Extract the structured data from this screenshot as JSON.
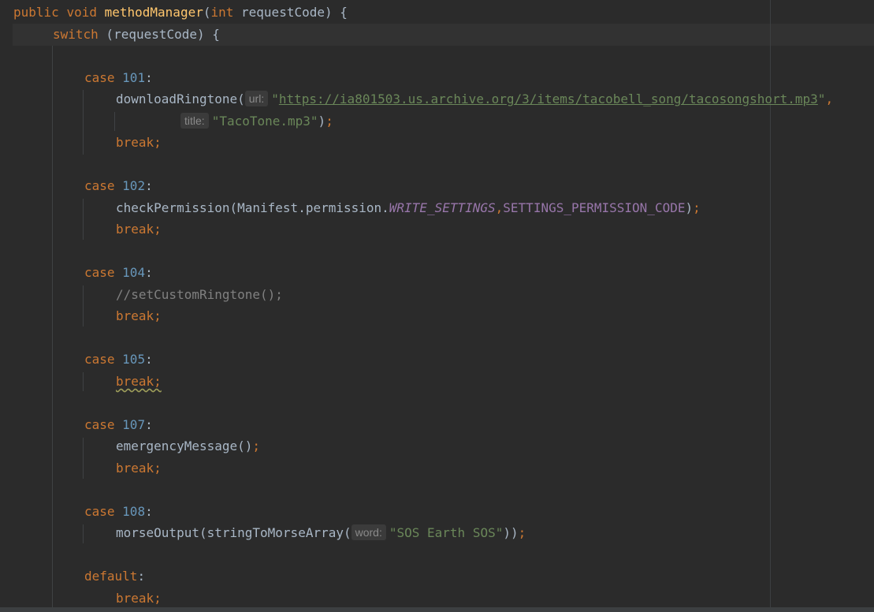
{
  "editor": {
    "lines": {
      "sig": {
        "kw_public": "public",
        "kw_void": "void",
        "name": "methodManager",
        "open": "(",
        "kw_int": "int",
        "rest": " requestCode) {"
      },
      "sw": {
        "kw": "switch",
        "rest": " (requestCode) {"
      },
      "c101": {
        "kw": "case",
        "num": "101",
        "colon": ":"
      },
      "dl": {
        "call": "downloadRingtone(",
        "hint": "url:",
        "q1": "\"",
        "url": "https://ia801503.us.archive.org/3/items/tacobell_song/tacosongshort.mp3",
        "q2": "\"",
        "comma": ","
      },
      "dl2": {
        "hint": "title:",
        "str": "\"TacoTone.mp3\"",
        "close": ")",
        "semi": ";"
      },
      "b1": "break;",
      "c102": {
        "kw": "case",
        "num": "102",
        "colon": ":"
      },
      "cp": {
        "call": "checkPermission(Manifest.permission.",
        "c1": "WRITE_SETTINGS",
        "comma": ",",
        "c2": "SETTINGS_PERMISSION_CODE",
        "close": ")",
        "semi": ";"
      },
      "b2": "break;",
      "c104": {
        "kw": "case",
        "num": "104",
        "colon": ":"
      },
      "cm": "//setCustomRingtone();",
      "b3": "break;",
      "c105": {
        "kw": "case",
        "num": "105",
        "colon": ":"
      },
      "b4": "break;",
      "c107": {
        "kw": "case",
        "num": "107",
        "colon": ":"
      },
      "em": {
        "call": "emergencyMessage()",
        "semi": ";"
      },
      "b5": "break;",
      "c108": {
        "kw": "case",
        "num": "108",
        "colon": ":"
      },
      "mo": {
        "call": "morseOutput(stringToMorseArray(",
        "hint": "word:",
        "str": "\"SOS Earth SOS\"",
        "close": "))",
        "semi": ";"
      },
      "def": {
        "kw": "default",
        "colon": ":"
      },
      "b6": "break;"
    }
  },
  "colors": {
    "background": "#2b2b2b",
    "keyword": "#cc7832",
    "number": "#6897bb",
    "string": "#6a8759",
    "function": "#ffc66d",
    "constant": "#9876aa",
    "comment": "#808080",
    "text": "#a9b7c6"
  }
}
